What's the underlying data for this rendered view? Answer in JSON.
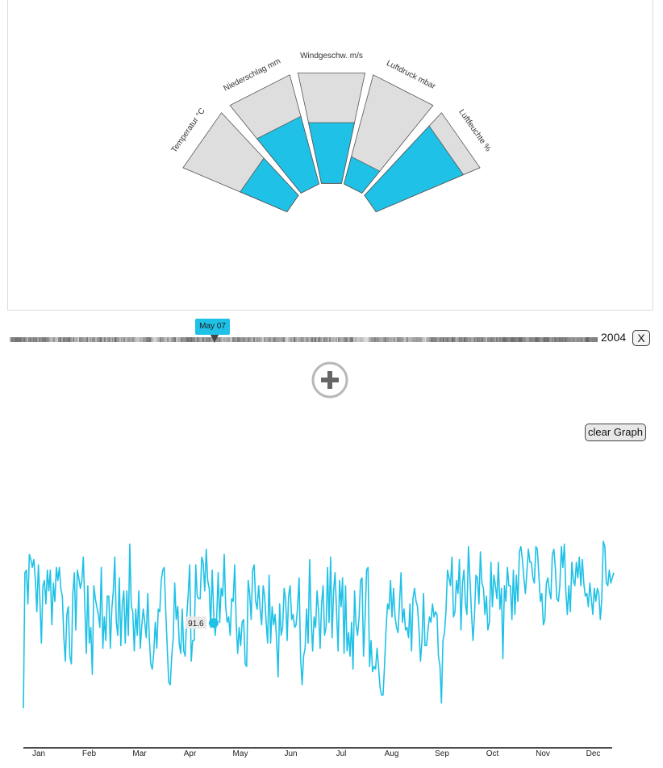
{
  "gauges": [
    {
      "label": "Temperatur °C",
      "fraction": 0.45
    },
    {
      "label": "Niederschlag mm",
      "fraction": 0.62
    },
    {
      "label": "Windgeschw. m/s",
      "fraction": 0.55
    },
    {
      "label": "Luftdruck mbar",
      "fraction": 0.25
    },
    {
      "label": "Luftfeuchte %",
      "fraction": 0.84
    }
  ],
  "timeline": {
    "marker_label": "May 07",
    "year": "2004",
    "close_label": "X"
  },
  "add_button": {
    "icon": "plus-circle-icon"
  },
  "clear_graph_label": "clear Graph",
  "colors": {
    "accent": "#1fc1e6",
    "empty": "#dedede",
    "outline": "#555555"
  },
  "chart_data": {
    "type": "line",
    "series": [
      {
        "values": [
          5,
          57,
          58,
          45,
          64,
          62,
          59,
          62,
          54,
          42,
          60,
          47,
          30,
          52,
          54,
          45,
          58,
          50,
          58,
          37,
          53,
          46,
          59,
          54,
          59,
          51,
          48,
          32,
          23,
          41,
          44,
          25,
          22,
          49,
          57,
          35,
          58,
          55,
          51,
          54,
          63,
          44,
          26,
          52,
          30,
          36,
          18,
          52,
          47,
          44,
          41,
          36,
          59,
          28,
          40,
          31,
          48,
          48,
          28,
          43,
          50,
          63,
          38,
          33,
          55,
          29,
          45,
          50,
          30,
          50,
          33,
          68,
          44,
          42,
          27,
          43,
          33,
          50,
          28,
          37,
          43,
          38,
          32,
          49,
          32,
          22,
          20,
          26,
          38,
          28,
          43,
          42,
          54,
          58,
          59,
          42,
          28,
          15,
          14,
          25,
          32,
          53,
          39,
          44,
          30,
          26,
          43,
          27,
          25,
          40,
          49,
          60,
          23,
          31,
          31,
          60,
          48,
          47,
          47,
          63,
          61,
          50,
          66,
          54,
          51,
          36,
          58,
          42,
          33,
          40,
          57,
          38,
          51,
          48,
          64,
          44,
          38,
          40,
          33,
          47,
          46,
          60,
          38,
          26,
          36,
          29,
          38,
          39,
          22,
          21,
          54,
          49,
          39,
          58,
          60,
          46,
          43,
          52,
          43,
          37,
          52,
          48,
          38,
          30,
          56,
          30,
          44,
          37,
          41,
          31,
          17,
          45,
          33,
          36,
          51,
          47,
          31,
          48,
          52,
          39,
          41,
          36,
          37,
          44,
          55,
          24,
          14,
          25,
          28,
          43,
          30,
          62,
          40,
          27,
          40,
          36,
          50,
          42,
          28,
          45,
          52,
          33,
          36,
          59,
          38,
          63,
          32,
          50,
          57,
          42,
          27,
          54,
          44,
          55,
          26,
          52,
          27,
          34,
          25,
          38,
          20,
          50,
          37,
          33,
          40,
          54,
          55,
          25,
          39,
          58,
          59,
          21,
          31,
          19,
          21,
          20,
          28,
          21,
          13,
          10,
          10,
          21,
          35,
          45,
          43,
          54,
          40,
          51,
          40,
          36,
          34,
          45,
          57,
          38,
          43,
          35,
          36,
          32,
          45,
          27,
          47,
          51,
          46,
          44,
          35,
          23,
          31,
          49,
          29,
          29,
          35,
          40,
          38,
          45,
          40,
          42,
          41,
          25,
          21,
          7,
          31,
          34,
          42,
          58,
          55,
          52,
          63,
          40,
          42,
          54,
          49,
          62,
          35,
          53,
          58,
          45,
          41,
          67,
          55,
          42,
          31,
          40,
          56,
          55,
          45,
          65,
          53,
          51,
          41,
          48,
          35,
          38,
          61,
          44,
          56,
          52,
          47,
          61,
          43,
          51,
          24,
          52,
          46,
          59,
          52,
          52,
          39,
          58,
          41,
          56,
          46,
          65,
          67,
          62,
          55,
          49,
          57,
          66,
          61,
          61,
          55,
          53,
          67,
          66,
          56,
          46,
          49,
          37,
          39,
          53,
          55,
          50,
          47,
          64,
          66,
          59,
          47,
          46,
          52,
          67,
          59,
          68,
          50,
          41,
          52,
          42,
          61,
          54,
          52,
          61,
          55,
          63,
          52,
          62,
          53,
          48,
          49,
          44,
          53,
          47,
          41,
          51,
          46,
          51,
          49,
          39,
          47,
          69,
          67,
          53,
          52,
          58,
          53,
          55,
          57
        ]
      }
    ],
    "x_ticks": [
      "Jan",
      "Feb",
      "Mar",
      "Apr",
      "May",
      "Jun",
      "Jul",
      "Aug",
      "Sep",
      "Oct",
      "Nov",
      "Dec"
    ],
    "highlight": {
      "index": 127,
      "label": "91.6"
    },
    "ylim": [
      0,
      100
    ],
    "grid": false,
    "xlabel": "",
    "ylabel": ""
  }
}
